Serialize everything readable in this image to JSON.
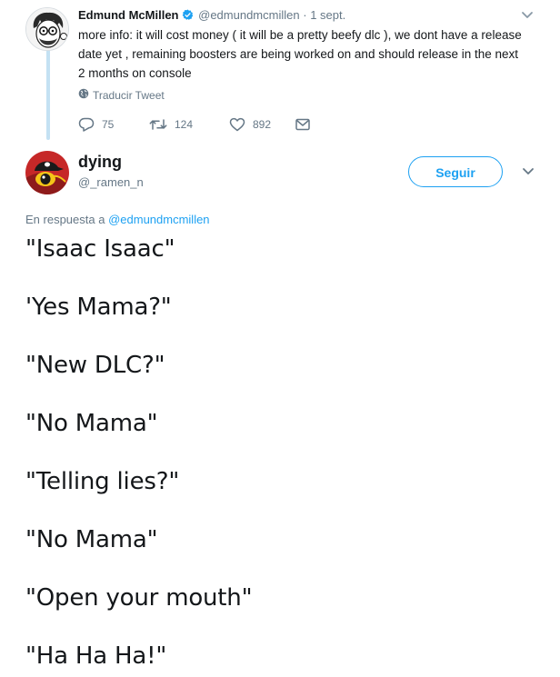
{
  "parent_tweet": {
    "author_name": "Edmund McMillen",
    "verified": true,
    "handle": "@edmundmcmillen",
    "separator": "·",
    "date": "1 sept.",
    "text": "more info: it will cost money ( it will be a pretty beefy dlc ), we dont have a release\ndate yet , remaining boosters are being worked on and should release in the next\n2 months on console",
    "translate_label": "Traducir Tweet",
    "stats": {
      "replies": "75",
      "retweets": "124",
      "likes": "892"
    },
    "icons": {
      "caret": "chevron-down-icon",
      "globe": "globe-icon",
      "reply": "reply-icon",
      "retweet": "retweet-icon",
      "like": "heart-icon",
      "dm": "envelope-icon",
      "verified": "verified-badge-icon"
    }
  },
  "reply_tweet": {
    "author_name": "dying",
    "handle": "@_ramen_n",
    "follow_label": "Seguir",
    "in_reply_prefix": "En respuesta a",
    "in_reply_handle": "@edmundmcmillen",
    "lines": [
      "\"Isaac Isaac\"",
      "'Yes Mama?\"",
      "\"New DLC?\"",
      "\"No Mama\"",
      "\"Telling lies?\"",
      "\"No Mama\"",
      "\"Open your mouth\"",
      "\"Ha Ha Ha!\""
    ]
  },
  "colors": {
    "accent": "#1da1f2",
    "secondary_text": "#657786",
    "thread_line": "#c4e1f3",
    "primary_text": "#14171a"
  }
}
